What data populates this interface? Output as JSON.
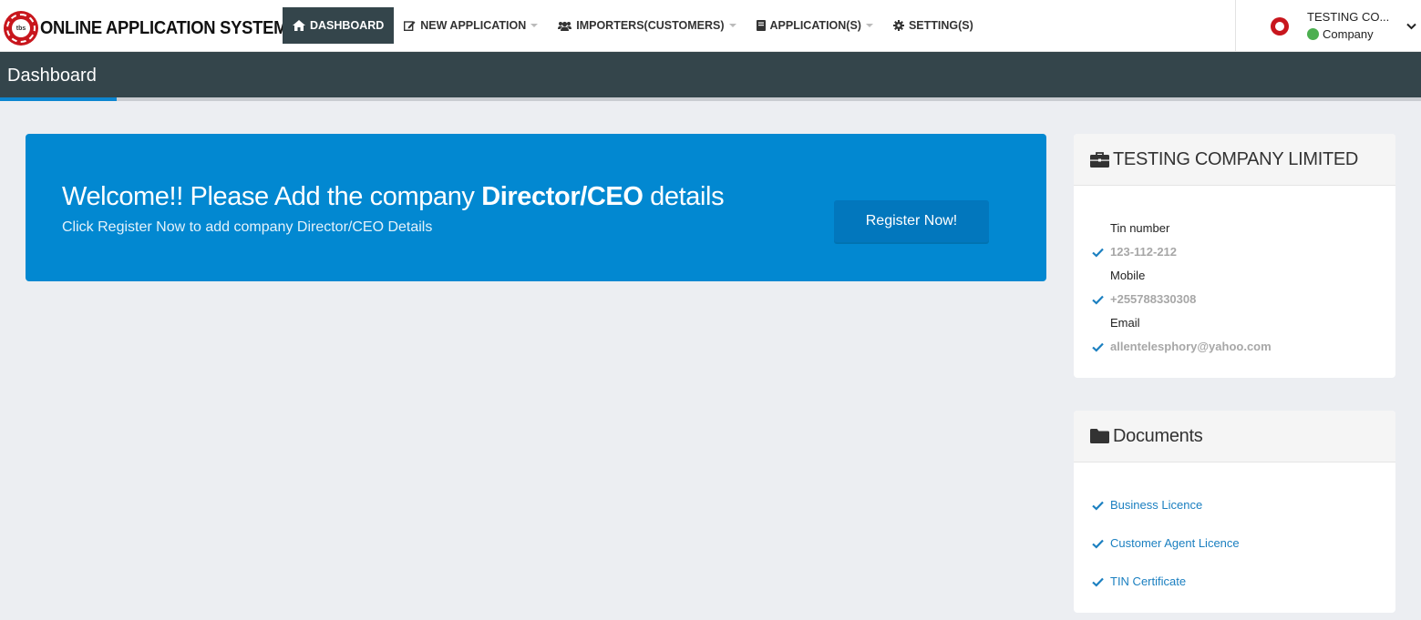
{
  "brand": {
    "title": "ONLINE APPLICATION SYSTEM",
    "logo_text": "tbs"
  },
  "nav": [
    {
      "label": "DASHBOARD",
      "icon": "home-icon",
      "active": true,
      "dropdown": false
    },
    {
      "label": "NEW APPLICATION",
      "icon": "edit-icon",
      "active": false,
      "dropdown": true
    },
    {
      "label": "IMPORTERS(CUSTOMERS)",
      "icon": "users-icon",
      "active": false,
      "dropdown": true
    },
    {
      "label": "APPLICATION(S)",
      "icon": "book-icon",
      "active": false,
      "dropdown": true
    },
    {
      "label": "SETTING(S)",
      "icon": "gear-icon",
      "active": false,
      "dropdown": false
    }
  ],
  "user": {
    "name": "TESTING CO...",
    "role": "Company",
    "status_color": "#4caf50"
  },
  "page": {
    "title": "Dashboard"
  },
  "banner": {
    "title_pre": "Welcome!! Please Add the company ",
    "title_bold": "Director/CEO",
    "title_post": " details",
    "subtitle": "Click Register Now to add company Director/CEO Details",
    "button": "Register Now!"
  },
  "company_card": {
    "title": "TESTING COMPANY LIMITED",
    "icon": "briefcase-icon",
    "rows": [
      {
        "label": "Tin number",
        "value": "123-112-212"
      },
      {
        "label": "Mobile",
        "value": "+255788330308"
      },
      {
        "label": "Email",
        "value": "allentelesphory@yahoo.com"
      }
    ]
  },
  "documents_card": {
    "title": "Documents",
    "icon": "folder-icon",
    "items": [
      "Business Licence",
      "Customer Agent Licence",
      "TIN Certificate"
    ]
  },
  "colors": {
    "header": "#34454b",
    "accent": "#0d86d0",
    "banner": "#0288d1",
    "button": "#0277bd",
    "link": "#1a7fc0"
  }
}
